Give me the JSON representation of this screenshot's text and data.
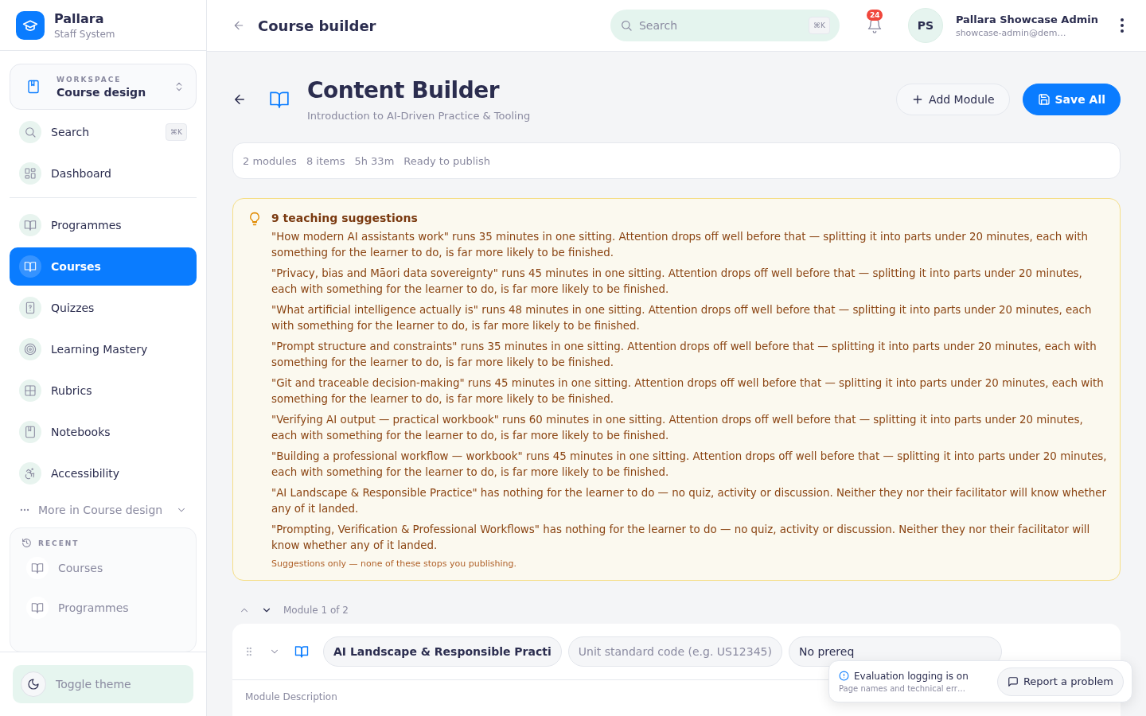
{
  "brand": {
    "name": "Pallara",
    "subtitle": "Staff System"
  },
  "workspace": {
    "label": "WORKSPACE",
    "name": "Course design"
  },
  "sidebar": {
    "search": {
      "label": "Search",
      "shortcut": "⌘K"
    },
    "top_items": [
      {
        "label": "Dashboard",
        "kind": "grid",
        "selected": false
      }
    ],
    "items": [
      {
        "label": "Programmes",
        "kind": "book",
        "selected": false
      },
      {
        "label": "Courses",
        "kind": "book",
        "selected": true
      },
      {
        "label": "Quizzes",
        "kind": "quiz",
        "selected": false
      },
      {
        "label": "Learning Mastery",
        "kind": "target",
        "selected": false
      },
      {
        "label": "Rubrics",
        "kind": "table",
        "selected": false
      },
      {
        "label": "Notebooks",
        "kind": "notebook",
        "selected": false
      },
      {
        "label": "Accessibility",
        "kind": "person",
        "selected": false
      }
    ],
    "more": "More in Course design",
    "recent": {
      "label": "RECENT",
      "items": [
        {
          "label": "Courses"
        },
        {
          "label": "Programmes"
        }
      ]
    },
    "toggle_theme": "Toggle theme"
  },
  "topbar": {
    "title": "Course builder",
    "search": {
      "placeholder": "Search",
      "shortcut": "⌘K"
    },
    "notifications": "24",
    "user": {
      "initials": "PS",
      "name": "Pallara Showcase Admin",
      "email": "showcase-admin@dem…"
    }
  },
  "page": {
    "title": "Content Builder",
    "subtitle": "Introduction to AI-Driven Practice & Tooling",
    "buttons": [
      {
        "label": "Add Module",
        "kind": "secondary"
      },
      {
        "label": "Save All",
        "kind": "primary"
      }
    ],
    "stats": [
      "2 modules",
      "8 items",
      "5h 33m",
      "Ready to publish"
    ]
  },
  "suggestions": {
    "title": "9 teaching suggestions",
    "items": [
      "\"How modern AI assistants work\" runs 35 minutes in one sitting. Attention drops off well before that — splitting it into parts under 20 minutes, each with something for the learner to do, is far more likely to be finished.",
      "\"Privacy, bias and Māori data sovereignty\" runs 45 minutes in one sitting. Attention drops off well before that — splitting it into parts under 20 minutes, each with something for the learner to do, is far more likely to be finished.",
      "\"What artificial intelligence actually is\" runs 48 minutes in one sitting. Attention drops off well before that — splitting it into parts under 20 minutes, each with something for the learner to do, is far more likely to be finished.",
      "\"Prompt structure and constraints\" runs 35 minutes in one sitting. Attention drops off well before that — splitting it into parts under 20 minutes, each with something for the learner to do, is far more likely to be finished.",
      "\"Git and traceable decision-making\" runs 45 minutes in one sitting. Attention drops off well before that — splitting it into parts under 20 minutes, each with something for the learner to do, is far more likely to be finished.",
      "\"Verifying AI output — practical workbook\" runs 60 minutes in one sitting. Attention drops off well before that — splitting it into parts under 20 minutes, each with something for the learner to do, is far more likely to be finished.",
      "\"Building a professional workflow — workbook\" runs 45 minutes in one sitting. Attention drops off well before that — splitting it into parts under 20 minutes, each with something for the learner to do, is far more likely to be finished.",
      "\"AI Landscape & Responsible Practice\" has nothing for the learner to do — no quiz, activity or discussion. Neither they nor their facilitator will know whether any of it landed.",
      "\"Prompting, Verification & Professional Workflows\" has nothing for the learner to do — no quiz, activity or discussion. Neither they nor their facilitator will know whether any of it landed."
    ],
    "footnote": "Suggestions only — none of these stops you publishing."
  },
  "module": {
    "position": "Module 1 of 2",
    "title_value": "AI Landscape & Responsible Practi",
    "unit_code_placeholder": "Unit standard code (e.g. US12345)",
    "prerequisite_value": "No prereq",
    "description_label": "Module Description"
  },
  "toast": {
    "title": "Evaluation logging is on",
    "text": "Page names and technical err…",
    "button": "Report a problem"
  }
}
